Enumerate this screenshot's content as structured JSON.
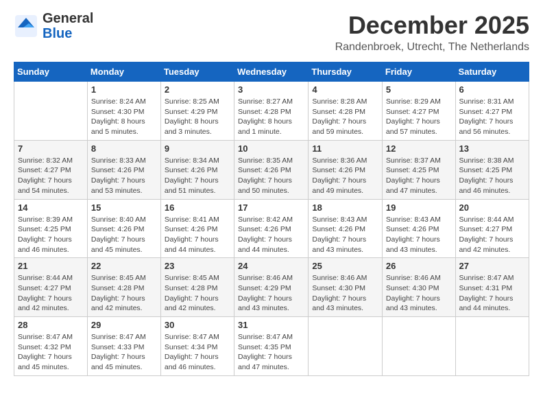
{
  "logo": {
    "line1": "General",
    "line2": "Blue"
  },
  "title": "December 2025",
  "location": "Randenbroek, Utrecht, The Netherlands",
  "weekdays": [
    "Sunday",
    "Monday",
    "Tuesday",
    "Wednesday",
    "Thursday",
    "Friday",
    "Saturday"
  ],
  "weeks": [
    [
      {
        "day": "",
        "info": ""
      },
      {
        "day": "1",
        "info": "Sunrise: 8:24 AM\nSunset: 4:30 PM\nDaylight: 8 hours\nand 5 minutes."
      },
      {
        "day": "2",
        "info": "Sunrise: 8:25 AM\nSunset: 4:29 PM\nDaylight: 8 hours\nand 3 minutes."
      },
      {
        "day": "3",
        "info": "Sunrise: 8:27 AM\nSunset: 4:28 PM\nDaylight: 8 hours\nand 1 minute."
      },
      {
        "day": "4",
        "info": "Sunrise: 8:28 AM\nSunset: 4:28 PM\nDaylight: 7 hours\nand 59 minutes."
      },
      {
        "day": "5",
        "info": "Sunrise: 8:29 AM\nSunset: 4:27 PM\nDaylight: 7 hours\nand 57 minutes."
      },
      {
        "day": "6",
        "info": "Sunrise: 8:31 AM\nSunset: 4:27 PM\nDaylight: 7 hours\nand 56 minutes."
      }
    ],
    [
      {
        "day": "7",
        "info": "Sunrise: 8:32 AM\nSunset: 4:27 PM\nDaylight: 7 hours\nand 54 minutes."
      },
      {
        "day": "8",
        "info": "Sunrise: 8:33 AM\nSunset: 4:26 PM\nDaylight: 7 hours\nand 53 minutes."
      },
      {
        "day": "9",
        "info": "Sunrise: 8:34 AM\nSunset: 4:26 PM\nDaylight: 7 hours\nand 51 minutes."
      },
      {
        "day": "10",
        "info": "Sunrise: 8:35 AM\nSunset: 4:26 PM\nDaylight: 7 hours\nand 50 minutes."
      },
      {
        "day": "11",
        "info": "Sunrise: 8:36 AM\nSunset: 4:26 PM\nDaylight: 7 hours\nand 49 minutes."
      },
      {
        "day": "12",
        "info": "Sunrise: 8:37 AM\nSunset: 4:25 PM\nDaylight: 7 hours\nand 47 minutes."
      },
      {
        "day": "13",
        "info": "Sunrise: 8:38 AM\nSunset: 4:25 PM\nDaylight: 7 hours\nand 46 minutes."
      }
    ],
    [
      {
        "day": "14",
        "info": "Sunrise: 8:39 AM\nSunset: 4:25 PM\nDaylight: 7 hours\nand 46 minutes."
      },
      {
        "day": "15",
        "info": "Sunrise: 8:40 AM\nSunset: 4:26 PM\nDaylight: 7 hours\nand 45 minutes."
      },
      {
        "day": "16",
        "info": "Sunrise: 8:41 AM\nSunset: 4:26 PM\nDaylight: 7 hours\nand 44 minutes."
      },
      {
        "day": "17",
        "info": "Sunrise: 8:42 AM\nSunset: 4:26 PM\nDaylight: 7 hours\nand 44 minutes."
      },
      {
        "day": "18",
        "info": "Sunrise: 8:43 AM\nSunset: 4:26 PM\nDaylight: 7 hours\nand 43 minutes."
      },
      {
        "day": "19",
        "info": "Sunrise: 8:43 AM\nSunset: 4:26 PM\nDaylight: 7 hours\nand 43 minutes."
      },
      {
        "day": "20",
        "info": "Sunrise: 8:44 AM\nSunset: 4:27 PM\nDaylight: 7 hours\nand 42 minutes."
      }
    ],
    [
      {
        "day": "21",
        "info": "Sunrise: 8:44 AM\nSunset: 4:27 PM\nDaylight: 7 hours\nand 42 minutes."
      },
      {
        "day": "22",
        "info": "Sunrise: 8:45 AM\nSunset: 4:28 PM\nDaylight: 7 hours\nand 42 minutes."
      },
      {
        "day": "23",
        "info": "Sunrise: 8:45 AM\nSunset: 4:28 PM\nDaylight: 7 hours\nand 42 minutes."
      },
      {
        "day": "24",
        "info": "Sunrise: 8:46 AM\nSunset: 4:29 PM\nDaylight: 7 hours\nand 43 minutes."
      },
      {
        "day": "25",
        "info": "Sunrise: 8:46 AM\nSunset: 4:30 PM\nDaylight: 7 hours\nand 43 minutes."
      },
      {
        "day": "26",
        "info": "Sunrise: 8:46 AM\nSunset: 4:30 PM\nDaylight: 7 hours\nand 43 minutes."
      },
      {
        "day": "27",
        "info": "Sunrise: 8:47 AM\nSunset: 4:31 PM\nDaylight: 7 hours\nand 44 minutes."
      }
    ],
    [
      {
        "day": "28",
        "info": "Sunrise: 8:47 AM\nSunset: 4:32 PM\nDaylight: 7 hours\nand 45 minutes."
      },
      {
        "day": "29",
        "info": "Sunrise: 8:47 AM\nSunset: 4:33 PM\nDaylight: 7 hours\nand 45 minutes."
      },
      {
        "day": "30",
        "info": "Sunrise: 8:47 AM\nSunset: 4:34 PM\nDaylight: 7 hours\nand 46 minutes."
      },
      {
        "day": "31",
        "info": "Sunrise: 8:47 AM\nSunset: 4:35 PM\nDaylight: 7 hours\nand 47 minutes."
      },
      {
        "day": "",
        "info": ""
      },
      {
        "day": "",
        "info": ""
      },
      {
        "day": "",
        "info": ""
      }
    ]
  ]
}
